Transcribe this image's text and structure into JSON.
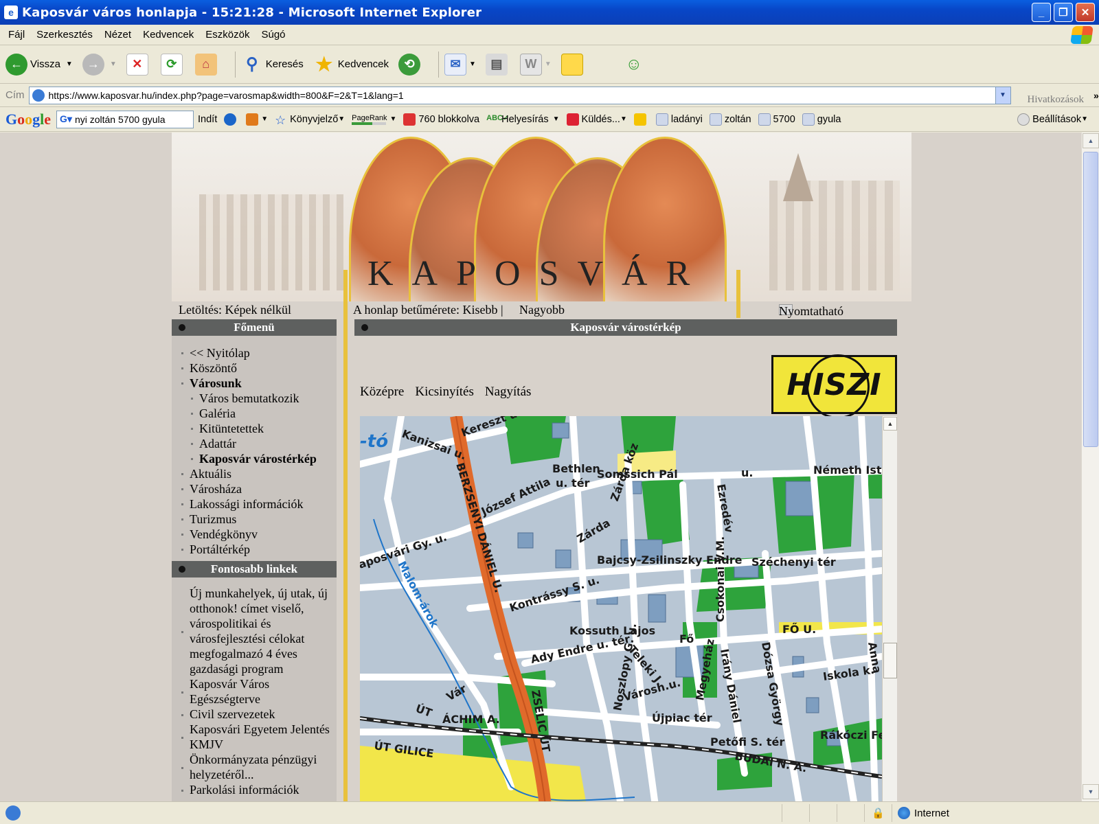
{
  "window": {
    "title": "Kaposvár város honlapja - 15:21:28 - Microsoft Internet Explorer",
    "controls": [
      "_",
      "❐",
      "✕"
    ]
  },
  "menubar": [
    "Fájl",
    "Szerkesztés",
    "Nézet",
    "Kedvencek",
    "Eszközök",
    "Súgó"
  ],
  "toolbar": {
    "back": "Vissza",
    "search": "Keresés",
    "favorites": "Kedvencek"
  },
  "address": {
    "label": "Cím",
    "url": "https://www.kaposvar.hu/index.php?page=varosmap&width=800&F=2&T=1&lang=1",
    "links": "Hivatkozások"
  },
  "googlebar": {
    "query": "nyi zoltán 5700 gyula",
    "go": "Indít",
    "bookmarks": "Könyvjelző",
    "pagerank": "PageRank",
    "blocked": "760 blokkolva",
    "spell": "Helyesírás",
    "send": "Küldés...",
    "terms": [
      "ladányi",
      "zoltán",
      "5700",
      "gyula"
    ],
    "settings": "Beállítások"
  },
  "page": {
    "brand": "KAPOSVÁR",
    "download": "Letöltés: Képek nélkül",
    "fontsize_label": "A honlap betűmérete: Kisebb |",
    "fontsize_larger": "Nagyobb",
    "print": "Nyomtatható forma",
    "main_menu_title": "Főmenü",
    "menu": [
      {
        "label": "<< Nyitólap",
        "level": 0,
        "bold": false
      },
      {
        "label": "Köszöntő",
        "level": 0,
        "bold": false
      },
      {
        "label": "Városunk",
        "level": 0,
        "bold": true
      },
      {
        "label": "Város bemutatkozik",
        "level": 1,
        "bold": false
      },
      {
        "label": "Galéria",
        "level": 1,
        "bold": false
      },
      {
        "label": "Kitüntetettek",
        "level": 1,
        "bold": false
      },
      {
        "label": "Adattár",
        "level": 1,
        "bold": false
      },
      {
        "label": "Kaposvár várostérkép",
        "level": 1,
        "bold": true
      },
      {
        "label": "Aktuális",
        "level": 0,
        "bold": false
      },
      {
        "label": "Városháza",
        "level": 0,
        "bold": false
      },
      {
        "label": "Lakossági információk",
        "level": 0,
        "bold": false
      },
      {
        "label": "Turizmus",
        "level": 0,
        "bold": false
      },
      {
        "label": "Vendégkönyv",
        "level": 0,
        "bold": false
      },
      {
        "label": "Portáltérkép",
        "level": 0,
        "bold": false
      }
    ],
    "links_title": "Fontosabb linkek",
    "links": [
      "Új munkahelyek, új utak, új otthonok! címet viselő, várospolitikai és városfejlesztési célokat megfogalmazó 4 éves gazdasági program",
      "Kaposvár Város Egészségterve",
      "Civil szervezetek",
      "Kaposvári Egyetem Jelentés KMJV",
      "Önkormányzata pénzügyi helyzetéről...",
      "Parkolási információk"
    ],
    "map_title": "Kaposvár várostérkép",
    "map_controls": [
      "Középre",
      "Kicsinyítés",
      "Nagyítás"
    ],
    "hiszi": "HISZI",
    "map_labels": [
      "Kanizsai u.",
      "Kereszt u.",
      "Bethlen",
      "Somssich Pál",
      "u.",
      "Németh Istv",
      "József Attila",
      "u. tér",
      "BERZSENYI DÁNIEL U.",
      "Bajcsy-Zsilinszky Endre",
      "Széchenyi tér",
      "aposvári Gy. u.",
      "Malom-árok",
      "Kontrássy S. u.",
      "Kossuth Lajos",
      "FŐ U.",
      "Ady Endre u. tér",
      "ZSELIC ÚT",
      "Iskola k.",
      "ÚT",
      "ÁCHIM A.",
      "Újpiac tér",
      "Petőfi S. tér",
      "BUDAI N. A.",
      "ÚT GILICE",
      "Rákóczi Fe tér",
      "Zárda",
      "Zárda köz",
      "Ezredév",
      "Dózsa György",
      "Anna",
      "Csokonai V.M.",
      "Teleki J.",
      "Városh.u.",
      "Noszlopy G. u.",
      "Irány Dániel",
      "Fő",
      "Vár",
      "Megyeház",
      "-tó"
    ]
  },
  "status": {
    "zone": "Internet"
  },
  "colors": {
    "title_bar": "#0846c7",
    "header_gray": "#5e605f",
    "accent_gold": "#e8c13c",
    "road_orange": "#e06a2b",
    "park_green": "#2ea33c",
    "water_blue": "#1f75c9",
    "yellow_road": "#f2e64a"
  }
}
